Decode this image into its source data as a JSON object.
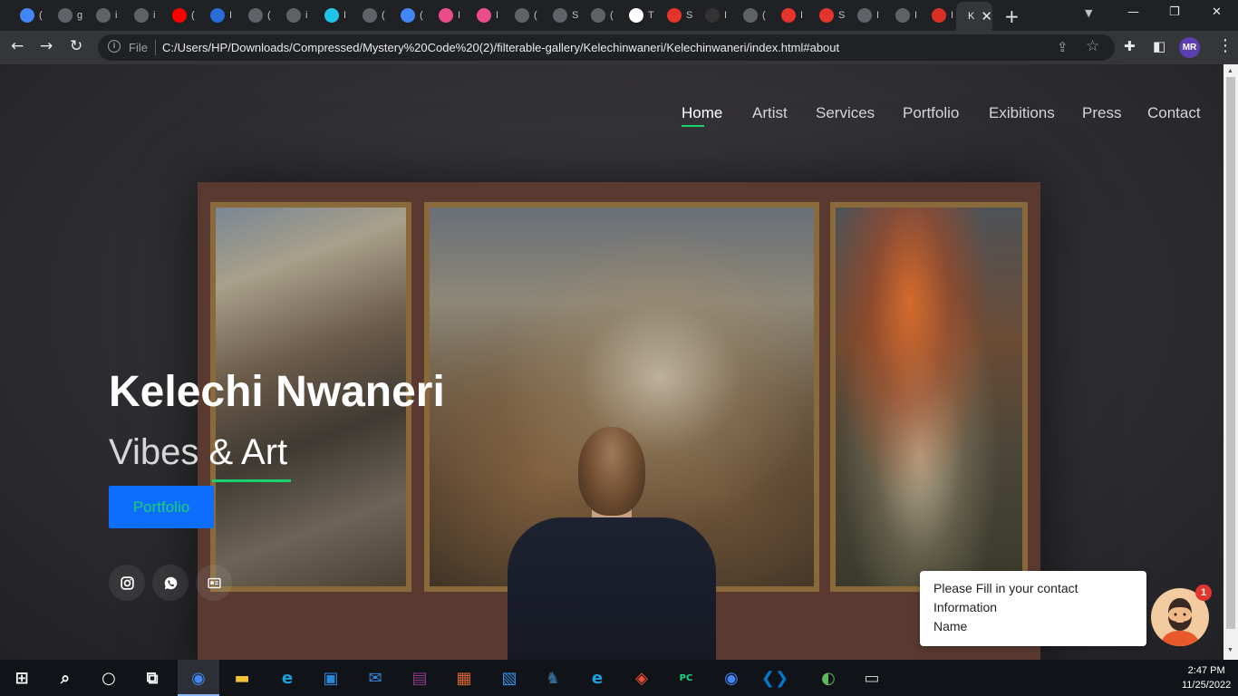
{
  "browser": {
    "tabs": [
      {
        "label": "(",
        "icon": "google-icon",
        "color": "#4285f4"
      },
      {
        "label": "g",
        "icon": "globe-icon",
        "color": "#5f6368"
      },
      {
        "label": "i",
        "icon": "globe-icon",
        "color": "#5f6368"
      },
      {
        "label": "i",
        "icon": "globe-icon",
        "color": "#5f6368"
      },
      {
        "label": "(",
        "icon": "youtube-icon",
        "color": "#ff0000"
      },
      {
        "label": "I",
        "icon": "video-icon",
        "color": "#2b6cd8"
      },
      {
        "label": "(",
        "icon": "globe-icon",
        "color": "#5f6368"
      },
      {
        "label": "i",
        "icon": "globe-icon",
        "color": "#5f6368"
      },
      {
        "label": "I",
        "icon": "apps-icon",
        "color": "#20c4e8"
      },
      {
        "label": "(",
        "icon": "globe-icon",
        "color": "#5f6368"
      },
      {
        "label": "(",
        "icon": "google-icon",
        "color": "#4285f4"
      },
      {
        "label": "I",
        "icon": "dribbble-icon",
        "color": "#ea4c89"
      },
      {
        "label": "I",
        "icon": "dribbble-icon",
        "color": "#ea4c89"
      },
      {
        "label": "(",
        "icon": "globe-icon",
        "color": "#5f6368"
      },
      {
        "label": "S",
        "icon": "globe-icon",
        "color": "#5f6368"
      },
      {
        "label": "(",
        "icon": "globe-icon",
        "color": "#5f6368"
      },
      {
        "label": "T",
        "icon": "codesandbox-icon",
        "color": "#ffffff"
      },
      {
        "label": "S",
        "icon": "s-icon",
        "color": "#e5342b"
      },
      {
        "label": "I",
        "icon": "github-icon",
        "color": "#333333"
      },
      {
        "label": "(",
        "icon": "globe-icon",
        "color": "#5f6368"
      },
      {
        "label": "I",
        "icon": "asterisk-icon",
        "color": "#e5342b"
      },
      {
        "label": "S",
        "icon": "s-icon",
        "color": "#e5342b"
      },
      {
        "label": "I",
        "icon": "globe-icon",
        "color": "#5f6368"
      },
      {
        "label": "I",
        "icon": "globe-icon",
        "color": "#5f6368"
      },
      {
        "label": "I",
        "icon": "hf-icon",
        "color": "#d93025"
      }
    ],
    "active_tab": {
      "label": "K",
      "close": "✕"
    },
    "new_tab": "+",
    "file_label": "File",
    "url": "C:/Users/HP/Downloads/Compressed/Mystery%20Code%20(2)/filterable-gallery/Kelechinwaneri/Kelechinwaneri/index.html#about",
    "profile_initials": "MR"
  },
  "site": {
    "nav": [
      "Home",
      "Artist",
      "Services",
      "Portfolio",
      "Exibitions",
      "Press",
      "Contact"
    ],
    "accent_color": "#18d26e",
    "hero": {
      "name": "Kelechi Nwaneri",
      "sub_plain": "Vibes ",
      "sub_accent": "& Art",
      "button": "Portfolio"
    },
    "social_icons": [
      "instagram-icon",
      "whatsapp-icon",
      "id-card-icon"
    ],
    "chat": {
      "lines": [
        "Please Fill in your contact",
        "Information",
        "Name"
      ],
      "badge": "1"
    }
  },
  "taskbar": {
    "time": "2:47 PM",
    "date": "11/25/2022",
    "apps": [
      "start-icon",
      "search-icon",
      "cortana-icon",
      "task-view-icon",
      "chrome-icon",
      "file-explorer-icon",
      "edge-icon",
      "store-icon",
      "mail-icon",
      "winrar-icon",
      "app-icon",
      "contacts-icon",
      "postgres-icon",
      "edge-icon",
      "git-icon",
      "pycharm-icon",
      "chrome-icon",
      "vscode-icon",
      "network-icon",
      "terminal-icon"
    ]
  }
}
